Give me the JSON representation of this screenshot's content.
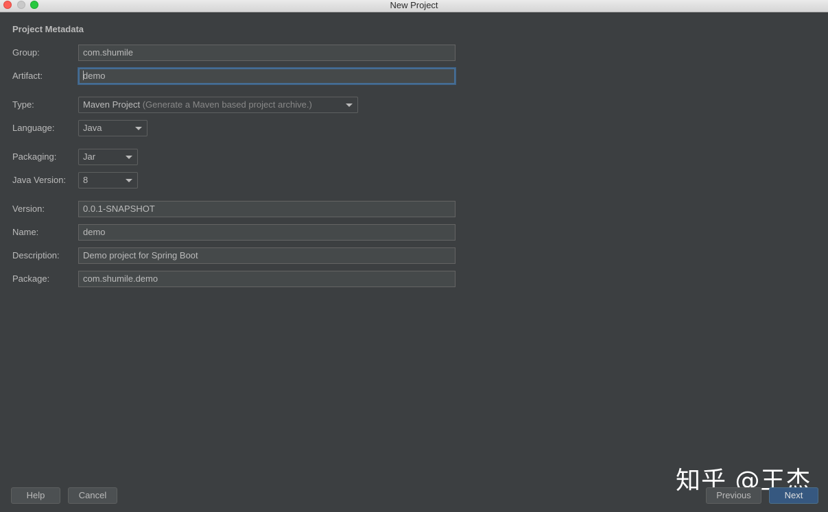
{
  "window": {
    "title": "New Project"
  },
  "section": {
    "title": "Project Metadata"
  },
  "fields": {
    "group": {
      "label": "Group:",
      "value": "com.shumile"
    },
    "artifact": {
      "label": "Artifact:",
      "value": "demo"
    },
    "type": {
      "label": "Type:",
      "value": "Maven Project",
      "hint": "(Generate a Maven based project archive.)"
    },
    "language": {
      "label": "Language:",
      "value": "Java"
    },
    "packaging": {
      "label": "Packaging:",
      "value": "Jar"
    },
    "java_version": {
      "label": "Java Version:",
      "value": "8"
    },
    "version": {
      "label": "Version:",
      "value": "0.0.1-SNAPSHOT"
    },
    "name": {
      "label": "Name:",
      "value": "demo"
    },
    "description": {
      "label": "Description:",
      "value": "Demo project for Spring Boot"
    },
    "package": {
      "label": "Package:",
      "value": "com.shumile.demo"
    }
  },
  "buttons": {
    "help": "Help",
    "cancel": "Cancel",
    "previous": "Previous",
    "next": "Next"
  },
  "watermark": "知乎 @王杰",
  "icons": [
    "close-light-icon",
    "minimize-light-icon",
    "maximize-light-icon",
    "dropdown-arrow-icon"
  ],
  "colors": {
    "background": "#3c3f41",
    "focus": "#466d94",
    "default_button": "#365880"
  }
}
